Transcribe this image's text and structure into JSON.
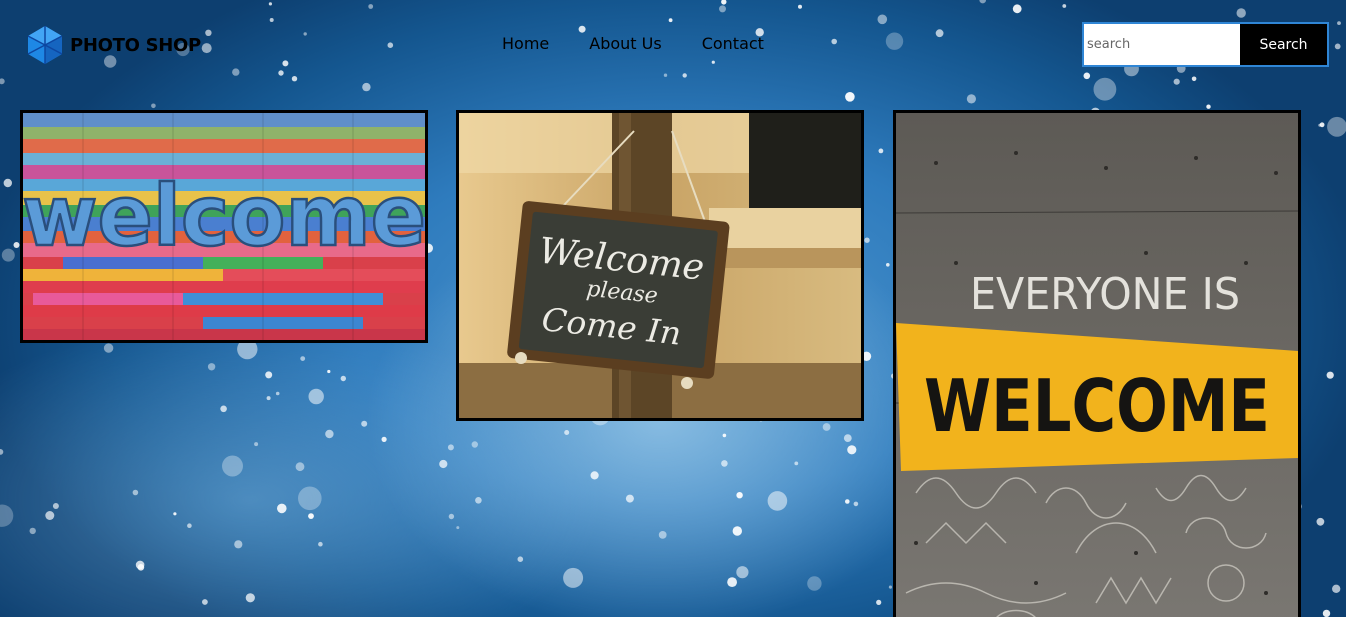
{
  "brand": {
    "name": "PHOTO SHOP",
    "logo_icon": "cube-logo-icon",
    "logo_color": "#1e88e5"
  },
  "nav": {
    "items": [
      {
        "label": "Home"
      },
      {
        "label": "About Us"
      },
      {
        "label": "Contact"
      }
    ]
  },
  "search": {
    "placeholder": "search",
    "value": "",
    "button_label": "Search",
    "border_color": "#2f86d6"
  },
  "gallery": {
    "photos": [
      {
        "name": "colorful-welcome-wall",
        "text": "welcome"
      },
      {
        "name": "welcome-chalkboard-sign",
        "lines": [
          "Welcome",
          "please",
          "Come In"
        ]
      },
      {
        "name": "everyone-is-welcome-wall",
        "line1": "EVERYONE IS",
        "line2": "WELCOME"
      }
    ]
  },
  "colors": {
    "background": "#2e7bbd",
    "accent": "#f2b31c"
  }
}
